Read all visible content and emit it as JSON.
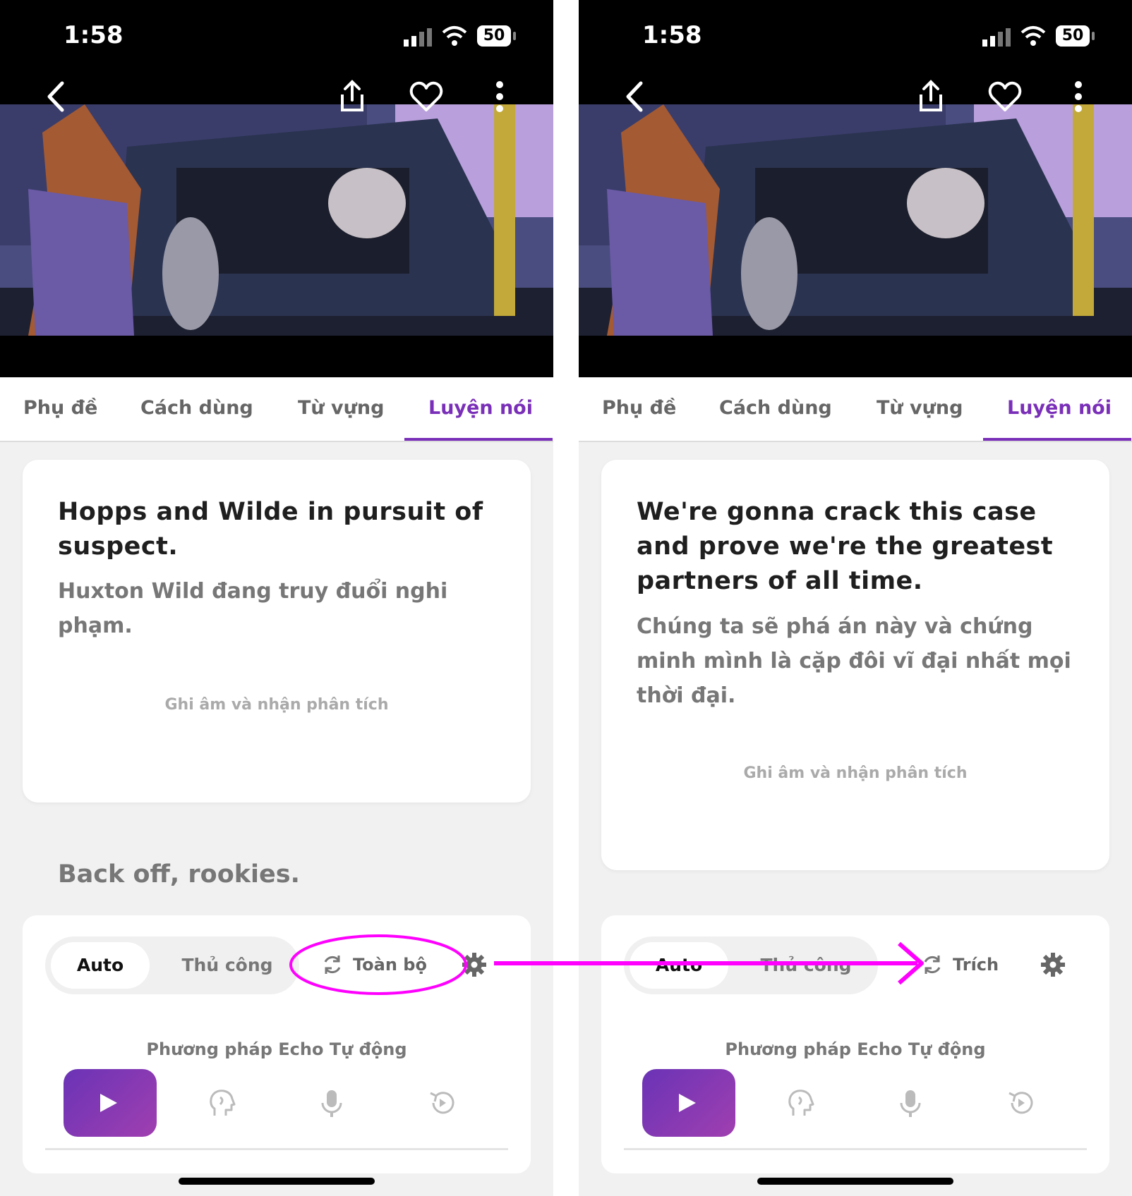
{
  "left": {
    "status": {
      "time": "1:58",
      "battery": "50"
    },
    "tabs": [
      "Phụ đề",
      "Cách dùng",
      "Từ vựng",
      "Luyện nói"
    ],
    "card": {
      "sentence_en": "Hopps and Wilde in pursuit of suspect.",
      "sentence_vi": "Huxton Wild đang truy đuổi nghi phạm.",
      "analyze_label": "Ghi âm và nhận phân tích"
    },
    "next_sentence": "Back off, rookies.",
    "controls": {
      "mode_auto": "Auto",
      "mode_manual": "Thủ công",
      "range_label": "Toàn bộ",
      "method_label": "Phương pháp Echo Tự động"
    }
  },
  "right": {
    "status": {
      "time": "1:58",
      "battery": "50"
    },
    "tabs": [
      "Phụ đề",
      "Cách dùng",
      "Từ vựng",
      "Luyện nói"
    ],
    "card": {
      "sentence_en": "We're gonna crack this case and prove we're the greatest partners of all time.",
      "sentence_vi": "Chúng ta sẽ phá án này và chứng minh mình là cặp đôi vĩ đại nhất mọi thời đại.",
      "analyze_label": "Ghi âm và nhận phân tích"
    },
    "controls": {
      "mode_auto": "Auto",
      "mode_manual": "Thủ công",
      "range_label": "Trích",
      "method_label": "Phương pháp Echo Tự động"
    }
  },
  "colors": {
    "accent": "#7a2fb8",
    "play_gradient_start": "#6a33b6",
    "play_gradient_end": "#a03fb0",
    "annotation": "#ff00ff"
  },
  "icons": [
    "back-arrow-icon",
    "share-icon",
    "heart-icon",
    "more-vertical-icon",
    "repeat-icon",
    "gear-icon",
    "play-icon",
    "head-listen-icon",
    "microphone-icon",
    "replay-icon"
  ]
}
